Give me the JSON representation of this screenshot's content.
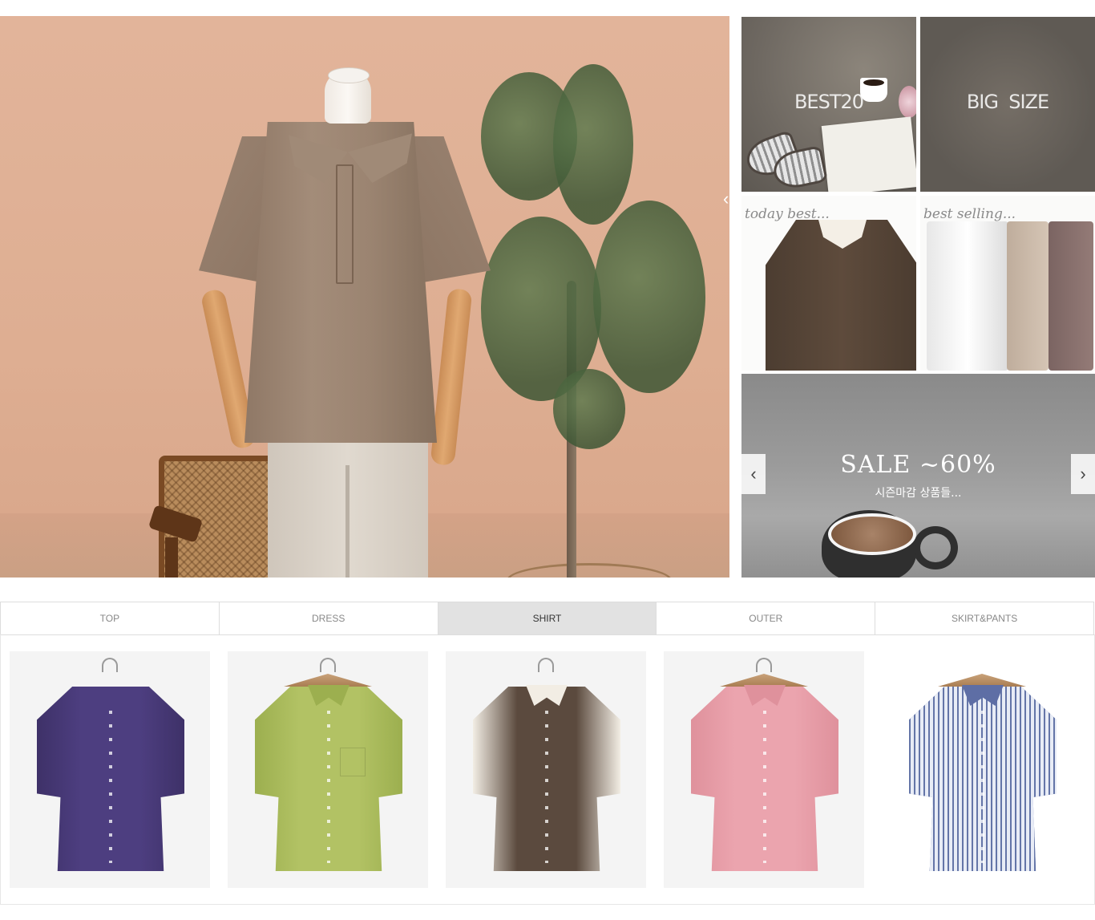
{
  "hero": {
    "slide_count": 3,
    "active_slide": 1
  },
  "side_banners": {
    "best20": {
      "label": "BEST20"
    },
    "big_size": {
      "label": "BIG  SIZE"
    },
    "today_best": {
      "label": "today best..."
    },
    "best_selling": {
      "label": "best selling..."
    },
    "sale": {
      "title": "SALE ~60%",
      "subtitle": "시즌마감 상품들...",
      "prev_icon": "chevron-left-icon",
      "next_icon": "chevron-right-icon"
    }
  },
  "category_tabs": {
    "active": "SHIRT",
    "items": [
      {
        "label": "TOP"
      },
      {
        "label": "DRESS"
      },
      {
        "label": "SHIRT"
      },
      {
        "label": "OUTER"
      },
      {
        "label": "SKIRT&PANTS"
      }
    ]
  },
  "products": [
    {
      "color": "#4d3e80",
      "accent": "#3e3168"
    },
    {
      "color": "#b2c264",
      "accent": "#9caf4f"
    },
    {
      "color": "#5b4a3e",
      "accent": "#f2ede4"
    },
    {
      "color": "#eba4ae",
      "accent": "#df919c"
    },
    {
      "color": "#7b88bb",
      "accent": "#5e6ea5"
    }
  ],
  "colors": {
    "tab_active_bg": "#e2e2e2",
    "tab_border": "#dddddd",
    "hero_bg": "#e2b49a"
  }
}
